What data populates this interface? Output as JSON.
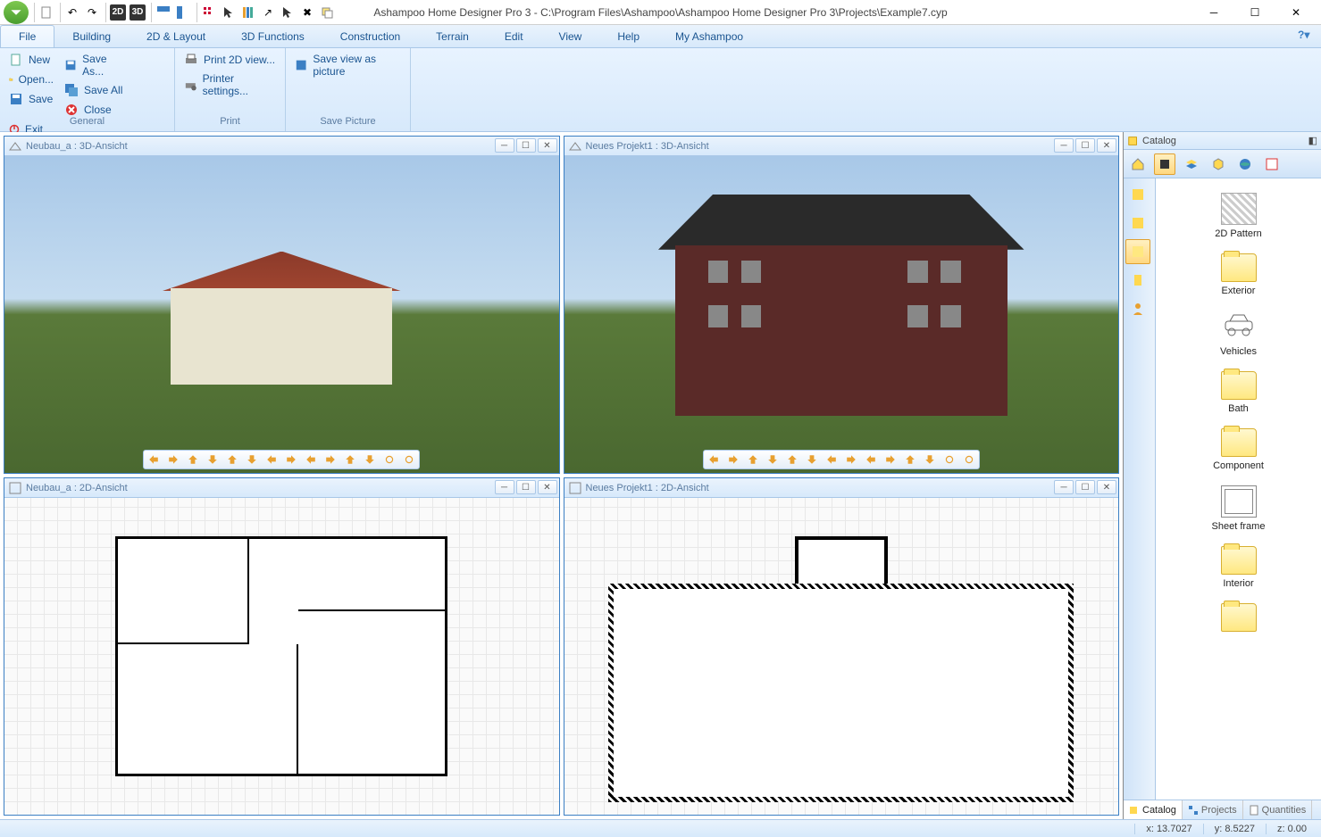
{
  "app": {
    "title": "Ashampoo Home Designer Pro 3 - C:\\Program Files\\Ashampoo\\Ashampoo Home Designer Pro 3\\Projects\\Example7.cyp"
  },
  "qat": {
    "btn_2d": "2D",
    "btn_3d": "3D"
  },
  "menu": {
    "tabs": [
      "File",
      "Building",
      "2D & Layout",
      "3D Functions",
      "Construction",
      "Terrain",
      "Edit",
      "View",
      "Help",
      "My Ashampoo"
    ],
    "active": 0
  },
  "ribbon": {
    "groups": [
      {
        "label": "General",
        "items": [
          {
            "label": "New",
            "icon": "new"
          },
          {
            "label": "Open...",
            "icon": "open"
          },
          {
            "label": "Save",
            "icon": "save"
          },
          {
            "label": "Save As...",
            "icon": "saveas"
          },
          {
            "label": "Save All",
            "icon": "saveall"
          },
          {
            "label": "Close",
            "icon": "close"
          },
          {
            "label": "Exit",
            "icon": "exit"
          }
        ]
      },
      {
        "label": "Print",
        "items": [
          {
            "label": "Print 2D view...",
            "icon": "printer"
          },
          {
            "label": "Printer settings...",
            "icon": "printer-gear"
          }
        ]
      },
      {
        "label": "Save Picture",
        "items": [
          {
            "label": "Save view as picture",
            "icon": "picture-save"
          }
        ]
      }
    ]
  },
  "viewports": [
    {
      "title": "Neubau_a : 3D-Ansicht",
      "type": "3d",
      "variant": 1
    },
    {
      "title": "Neues Projekt1 : 3D-Ansicht",
      "type": "3d",
      "variant": 2
    },
    {
      "title": "Neubau_a : 2D-Ansicht",
      "type": "2d",
      "variant": 1
    },
    {
      "title": "Neues Projekt1 : 2D-Ansicht",
      "type": "2d",
      "variant": 2
    }
  ],
  "catalog": {
    "title": "Catalog",
    "items": [
      {
        "label": "2D Pattern",
        "type": "pattern"
      },
      {
        "label": "Exterior",
        "type": "folder"
      },
      {
        "label": "Vehicles",
        "type": "car"
      },
      {
        "label": "Bath",
        "type": "folder"
      },
      {
        "label": "Component",
        "type": "folder"
      },
      {
        "label": "Sheet frame",
        "type": "sheet"
      },
      {
        "label": "Interior",
        "type": "folder"
      }
    ],
    "bottom_tabs": [
      "Catalog",
      "Projects",
      "Quantities"
    ],
    "bottom_active": 0
  },
  "status": {
    "x": "x: 13.7027",
    "y": "y: 8.5227",
    "z": "z: 0.00"
  }
}
